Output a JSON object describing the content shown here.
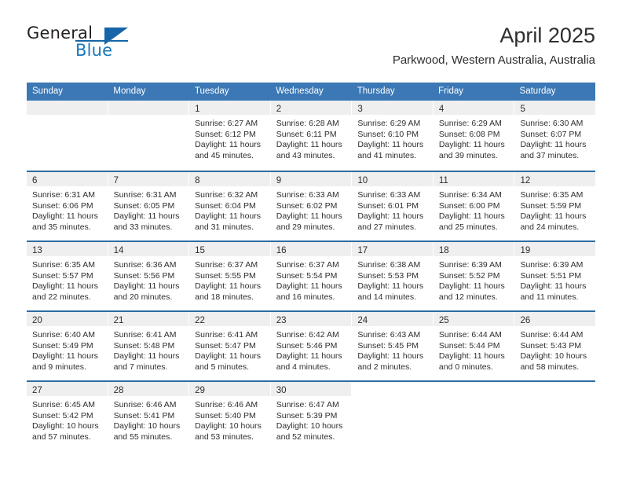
{
  "brand": {
    "word_one": "General",
    "word_two": "Blue",
    "logo_icon": "triangle-icon"
  },
  "header": {
    "title": "April 2025",
    "subtitle": "Parkwood, Western Australia, Australia"
  },
  "colors": {
    "header_blue": "#3b78b5",
    "row_rule_blue": "#2e6ca4",
    "daynum_band": "#efefef",
    "brand_blue": "#1878be",
    "text": "#2e2e2e"
  },
  "weekday_headers": [
    "Sunday",
    "Monday",
    "Tuesday",
    "Wednesday",
    "Thursday",
    "Friday",
    "Saturday"
  ],
  "weeks": [
    [
      {
        "day": "",
        "empty": true,
        "lines": []
      },
      {
        "day": "",
        "empty": true,
        "lines": []
      },
      {
        "day": "1",
        "lines": [
          "Sunrise: 6:27 AM",
          "Sunset: 6:12 PM",
          "Daylight: 11 hours",
          "and 45 minutes."
        ]
      },
      {
        "day": "2",
        "lines": [
          "Sunrise: 6:28 AM",
          "Sunset: 6:11 PM",
          "Daylight: 11 hours",
          "and 43 minutes."
        ]
      },
      {
        "day": "3",
        "lines": [
          "Sunrise: 6:29 AM",
          "Sunset: 6:10 PM",
          "Daylight: 11 hours",
          "and 41 minutes."
        ]
      },
      {
        "day": "4",
        "lines": [
          "Sunrise: 6:29 AM",
          "Sunset: 6:08 PM",
          "Daylight: 11 hours",
          "and 39 minutes."
        ]
      },
      {
        "day": "5",
        "lines": [
          "Sunrise: 6:30 AM",
          "Sunset: 6:07 PM",
          "Daylight: 11 hours",
          "and 37 minutes."
        ]
      }
    ],
    [
      {
        "day": "6",
        "lines": [
          "Sunrise: 6:31 AM",
          "Sunset: 6:06 PM",
          "Daylight: 11 hours",
          "and 35 minutes."
        ]
      },
      {
        "day": "7",
        "lines": [
          "Sunrise: 6:31 AM",
          "Sunset: 6:05 PM",
          "Daylight: 11 hours",
          "and 33 minutes."
        ]
      },
      {
        "day": "8",
        "lines": [
          "Sunrise: 6:32 AM",
          "Sunset: 6:04 PM",
          "Daylight: 11 hours",
          "and 31 minutes."
        ]
      },
      {
        "day": "9",
        "lines": [
          "Sunrise: 6:33 AM",
          "Sunset: 6:02 PM",
          "Daylight: 11 hours",
          "and 29 minutes."
        ]
      },
      {
        "day": "10",
        "lines": [
          "Sunrise: 6:33 AM",
          "Sunset: 6:01 PM",
          "Daylight: 11 hours",
          "and 27 minutes."
        ]
      },
      {
        "day": "11",
        "lines": [
          "Sunrise: 6:34 AM",
          "Sunset: 6:00 PM",
          "Daylight: 11 hours",
          "and 25 minutes."
        ]
      },
      {
        "day": "12",
        "lines": [
          "Sunrise: 6:35 AM",
          "Sunset: 5:59 PM",
          "Daylight: 11 hours",
          "and 24 minutes."
        ]
      }
    ],
    [
      {
        "day": "13",
        "lines": [
          "Sunrise: 6:35 AM",
          "Sunset: 5:57 PM",
          "Daylight: 11 hours",
          "and 22 minutes."
        ]
      },
      {
        "day": "14",
        "lines": [
          "Sunrise: 6:36 AM",
          "Sunset: 5:56 PM",
          "Daylight: 11 hours",
          "and 20 minutes."
        ]
      },
      {
        "day": "15",
        "lines": [
          "Sunrise: 6:37 AM",
          "Sunset: 5:55 PM",
          "Daylight: 11 hours",
          "and 18 minutes."
        ]
      },
      {
        "day": "16",
        "lines": [
          "Sunrise: 6:37 AM",
          "Sunset: 5:54 PM",
          "Daylight: 11 hours",
          "and 16 minutes."
        ]
      },
      {
        "day": "17",
        "lines": [
          "Sunrise: 6:38 AM",
          "Sunset: 5:53 PM",
          "Daylight: 11 hours",
          "and 14 minutes."
        ]
      },
      {
        "day": "18",
        "lines": [
          "Sunrise: 6:39 AM",
          "Sunset: 5:52 PM",
          "Daylight: 11 hours",
          "and 12 minutes."
        ]
      },
      {
        "day": "19",
        "lines": [
          "Sunrise: 6:39 AM",
          "Sunset: 5:51 PM",
          "Daylight: 11 hours",
          "and 11 minutes."
        ]
      }
    ],
    [
      {
        "day": "20",
        "lines": [
          "Sunrise: 6:40 AM",
          "Sunset: 5:49 PM",
          "Daylight: 11 hours",
          "and 9 minutes."
        ]
      },
      {
        "day": "21",
        "lines": [
          "Sunrise: 6:41 AM",
          "Sunset: 5:48 PM",
          "Daylight: 11 hours",
          "and 7 minutes."
        ]
      },
      {
        "day": "22",
        "lines": [
          "Sunrise: 6:41 AM",
          "Sunset: 5:47 PM",
          "Daylight: 11 hours",
          "and 5 minutes."
        ]
      },
      {
        "day": "23",
        "lines": [
          "Sunrise: 6:42 AM",
          "Sunset: 5:46 PM",
          "Daylight: 11 hours",
          "and 4 minutes."
        ]
      },
      {
        "day": "24",
        "lines": [
          "Sunrise: 6:43 AM",
          "Sunset: 5:45 PM",
          "Daylight: 11 hours",
          "and 2 minutes."
        ]
      },
      {
        "day": "25",
        "lines": [
          "Sunrise: 6:44 AM",
          "Sunset: 5:44 PM",
          "Daylight: 11 hours",
          "and 0 minutes."
        ]
      },
      {
        "day": "26",
        "lines": [
          "Sunrise: 6:44 AM",
          "Sunset: 5:43 PM",
          "Daylight: 10 hours",
          "and 58 minutes."
        ]
      }
    ],
    [
      {
        "day": "27",
        "lines": [
          "Sunrise: 6:45 AM",
          "Sunset: 5:42 PM",
          "Daylight: 10 hours",
          "and 57 minutes."
        ]
      },
      {
        "day": "28",
        "lines": [
          "Sunrise: 6:46 AM",
          "Sunset: 5:41 PM",
          "Daylight: 10 hours",
          "and 55 minutes."
        ]
      },
      {
        "day": "29",
        "lines": [
          "Sunrise: 6:46 AM",
          "Sunset: 5:40 PM",
          "Daylight: 10 hours",
          "and 53 minutes."
        ]
      },
      {
        "day": "30",
        "lines": [
          "Sunrise: 6:47 AM",
          "Sunset: 5:39 PM",
          "Daylight: 10 hours",
          "and 52 minutes."
        ]
      },
      {
        "day": "",
        "blank": true,
        "lines": []
      },
      {
        "day": "",
        "blank": true,
        "lines": []
      },
      {
        "day": "",
        "blank": true,
        "lines": []
      }
    ]
  ]
}
